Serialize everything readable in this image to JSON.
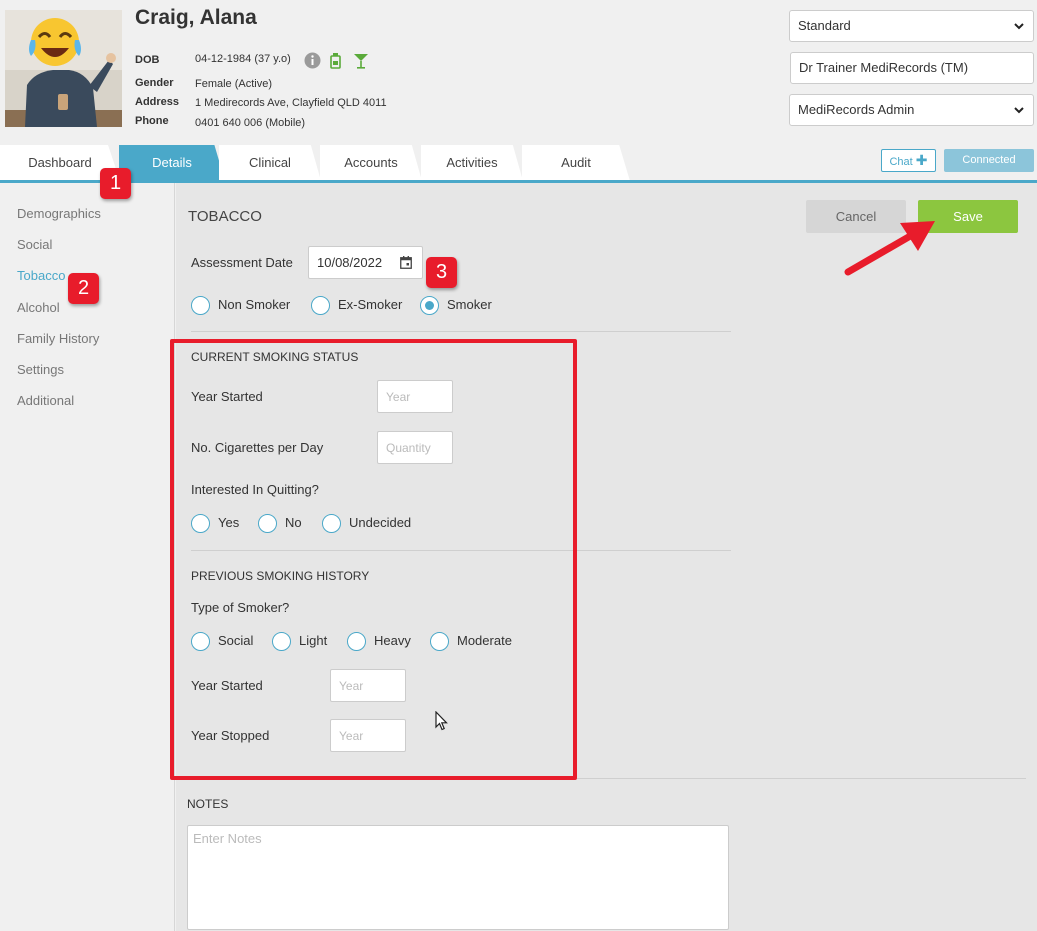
{
  "patient": {
    "name": "Craig, Alana",
    "dob_label": "DOB",
    "dob_value": "04-12-1984 (37 y.o)",
    "gender_label": "Gender",
    "gender_value": "Female (Active)",
    "address_label": "Address",
    "address_value": "1 Medirecords Ave, Clayfield QLD 4011",
    "phone_label": "Phone",
    "phone_value": "0401 640 006 (Mobile)"
  },
  "header_selects": {
    "template": "Standard",
    "practitioner": "Dr Trainer MediRecords (TM)",
    "role": "MediRecords Admin"
  },
  "tabs": [
    {
      "label": "Dashboard"
    },
    {
      "label": "Details"
    },
    {
      "label": "Clinical"
    },
    {
      "label": "Accounts"
    },
    {
      "label": "Activities"
    },
    {
      "label": "Audit"
    }
  ],
  "chat_label": "Chat",
  "connected_label": "Connected",
  "sidebar": {
    "items": [
      {
        "label": "Demographics"
      },
      {
        "label": "Social"
      },
      {
        "label": "Tobacco"
      },
      {
        "label": "Alcohol"
      },
      {
        "label": "Family History"
      },
      {
        "label": "Settings"
      },
      {
        "label": "Additional"
      }
    ]
  },
  "tobacco": {
    "title": "TOBACCO",
    "cancel_label": "Cancel",
    "save_label": "Save",
    "assessment_date_label": "Assessment Date",
    "assessment_date_value": "10/08/2022",
    "status_options": [
      "Non Smoker",
      "Ex-Smoker",
      "Smoker"
    ],
    "current": {
      "title": "CURRENT SMOKING STATUS",
      "year_started_label": "Year Started",
      "year_placeholder": "Year",
      "cigs_label": "No. Cigarettes per Day",
      "cigs_placeholder": "Quantity",
      "quitting_label": "Interested In Quitting?",
      "quitting_options": [
        "Yes",
        "No",
        "Undecided"
      ]
    },
    "previous": {
      "title": "PREVIOUS SMOKING HISTORY",
      "type_label": "Type of Smoker?",
      "type_options": [
        "Social",
        "Light",
        "Heavy",
        "Moderate"
      ],
      "year_started_label": "Year Started",
      "year_stopped_label": "Year Stopped",
      "year_placeholder": "Year"
    },
    "notes_title": "NOTES",
    "notes_placeholder": "Enter Notes"
  },
  "annotations": {
    "badge1": "1",
    "badge2": "2",
    "badge3": "3"
  },
  "colors": {
    "accent": "#4aa8c9",
    "save": "#8cc63f",
    "annotation": "#e81c2b"
  }
}
